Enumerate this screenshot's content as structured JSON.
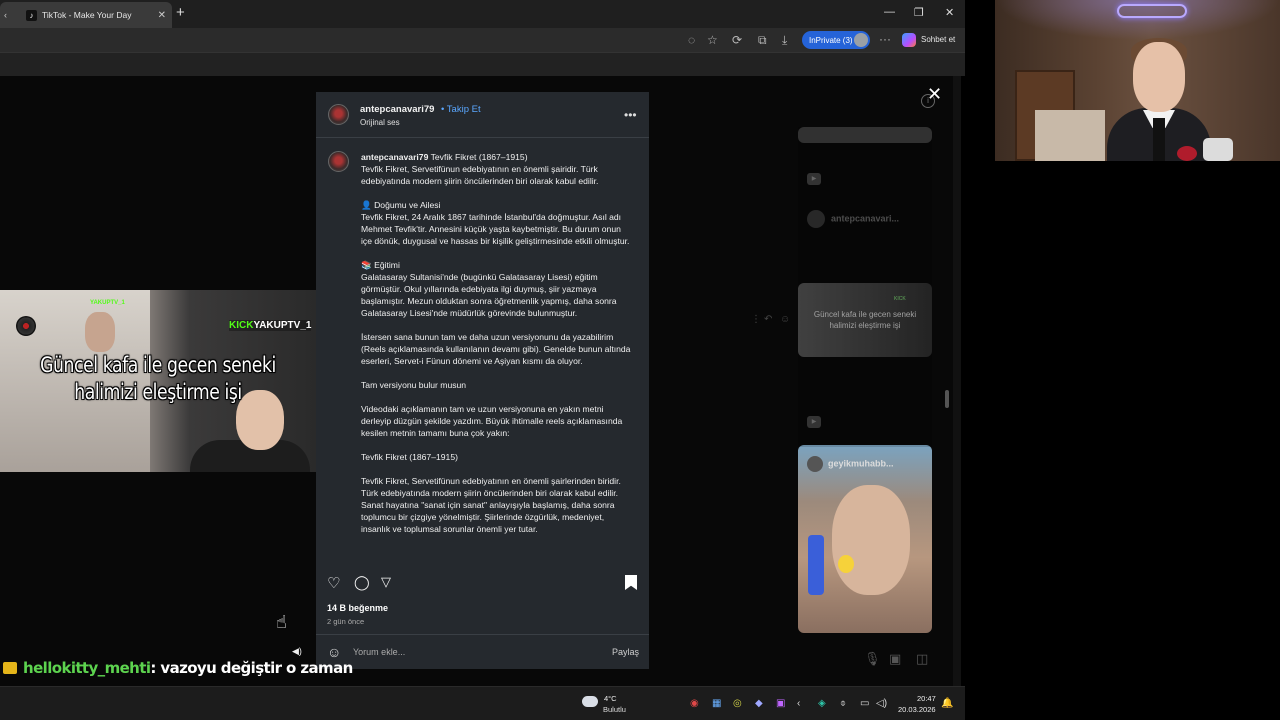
{
  "browser": {
    "tab_title": "TikTok - Make Your Day",
    "tab_favicon": "tiktok-icon",
    "inprivate_label": "InPrivate (3)",
    "copilot_label": "Sohbet et"
  },
  "video": {
    "caption_line1": "Güncel kafa ile gecen seneki",
    "caption_line2": "halimizi eleştirme işi",
    "overlay_small": "YAKUPTV_1",
    "overlay_big_k": "KICK",
    "overlay_big_name": "YAKUPTV_1"
  },
  "post": {
    "username": "antepcanavari79",
    "follow_label": "Takip Et",
    "audio_label": "Orijinal ses",
    "caption_title": "Tevfik Fikret (1867–1915)",
    "caption_paragraphs": [
      "Tevfik Fikret, Servetifünun edebiyatının en önemli şairidir. Türk edebiyatında modern şiirin öncülerinden biri olarak kabul edilir.",
      "👤 Doğumu ve Ailesi\nTevfik Fikret, 24 Aralık 1867 tarihinde İstanbul'da doğmuştur. Asıl adı Mehmet Tevfik'tir. Annesini küçük yaşta kaybetmiştir. Bu durum onun içe dönük, duygusal ve hassas bir kişilik geliştirmesinde etkili olmuştur.",
      "📚 Eğitimi\nGalatasaray Sultanisi'nde (bugünkü Galatasaray Lisesi) eğitim görmüştür. Okul yıllarında edebiyata ilgi duymuş, şiir yazmaya başlamıştır. Mezun olduktan sonra öğretmenlik yapmış, daha sonra Galatasaray Lisesi'nde müdürlük görevinde bulunmuştur.",
      "İstersen sana bunun tam ve daha uzun versiyonunu da yazabilirim (Reels açıklamasında kullanılanın devamı gibi). Genelde bunun altında eserleri, Servet-i Fünun dönemi ve Aşiyan kısmı da oluyor.",
      "Tam versiyonu bulur musun",
      "Videodaki açıklamanın tam ve uzun versiyonuna en yakın metni derleyip düzgün şekilde yazdım. Büyük ihtimalle reels açıklamasında kesilen metnin tamamı buna çok yakın:",
      "Tevfik Fikret (1867–1915)",
      "Tevfik Fikret, Servetifünun edebiyatının en önemli şairlerinden biridir. Türk edebiyatında modern şiirin öncülerinden biri olarak kabul edilir. Sanat hayatına \"sanat için sanat\" anlayışıyla başlamış, daha sonra toplumcu bir çizgiye yönelmiştir. Şiirlerinde özgürlük, medeniyet, insanlık ve toplumsal sorunlar önemli yer tutar."
    ],
    "likes": "14 B beğenme",
    "time_ago": "2 gün önce",
    "comment_placeholder": "Yorum ekle...",
    "post_button": "Paylaş"
  },
  "feed": {
    "item1_user": "antepcanavari...",
    "item2_caption_line1": "Güncel kafa ile gecen seneki",
    "item2_caption_line2": "halimizi eleştirme işi",
    "item3_user": "geyikmuhabb..."
  },
  "chat": {
    "username": "hellokitty_mehti",
    "message": ": vazoyu değiştir o zaman"
  },
  "taskbar": {
    "temperature": "4°C",
    "weather": "Bulutlu",
    "time": "20:47",
    "date": "20.03.2026"
  },
  "colors": {
    "follow": "#5aa7ff",
    "inprivate": "#2563d8",
    "chat_name": "#5dd34f",
    "kick_green": "#53fc18"
  }
}
